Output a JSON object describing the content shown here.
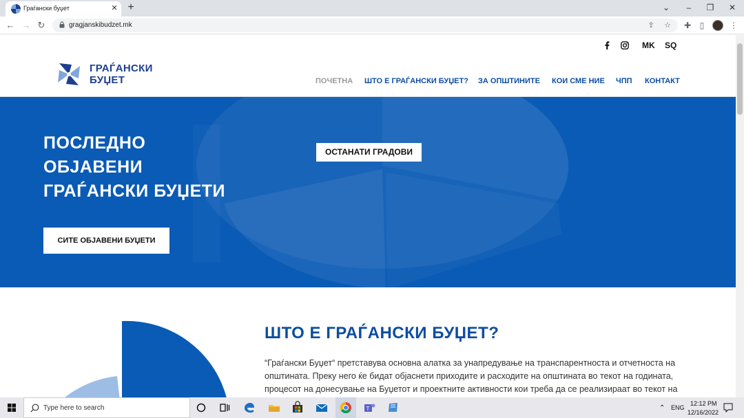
{
  "browser": {
    "tab_title": "Граѓански буџет",
    "new_tab": "+",
    "url": "gragjanskibudzet.mk"
  },
  "header": {
    "social": [
      "facebook-icon",
      "instagram-icon"
    ],
    "languages": [
      "MK",
      "SQ"
    ],
    "logo_line1": "ГРАЃАНСКИ",
    "logo_line2": "БУЏЕТ",
    "nav": [
      {
        "label": "ПОЧЕТНА",
        "active": true
      },
      {
        "label": "ШТО Е ГРАЃАНСКИ БУЏЕТ?",
        "active": false
      },
      {
        "label": "ЗА ОПШТИНИТЕ",
        "active": false
      },
      {
        "label": "КОИ СМЕ НИЕ",
        "active": false
      },
      {
        "label": "ЧПП",
        "active": false
      },
      {
        "label": "КОНТАКТ",
        "active": false
      }
    ]
  },
  "hero": {
    "title_line1": "ПОСЛЕДНО",
    "title_line2": "ОБЈАВЕНИ",
    "title_line3": "ГРАЃАНСКИ БУЏЕТИ",
    "all_button": "СИТЕ ОБЈАВЕНИ БУЏЕТИ",
    "other_button": "ОСТАНАТИ ГРАДОВИ"
  },
  "intro": {
    "title": "ШТО Е ГРАЃАНСКИ БУЏЕТ?",
    "lines": [
      "“Граѓански Буџет“ претставува основна алатка за унапредување на транспарентноста и отчетноста на",
      "општината. Преку него ќе бидат објаснети приходите и расходите на општината во текот на годината,",
      "процесот на донесување на Буџетот и проектните активности кои треба да се реализираат во текот на"
    ]
  },
  "taskbar": {
    "search_placeholder": "Type here to search",
    "lang": "ENG",
    "time": "12:12 PM",
    "date": "12/16/2022"
  },
  "colors": {
    "brand_blue": "#0a5bb5",
    "nav_blue": "#0c4da2",
    "nav_active": "#9a9a9a"
  }
}
